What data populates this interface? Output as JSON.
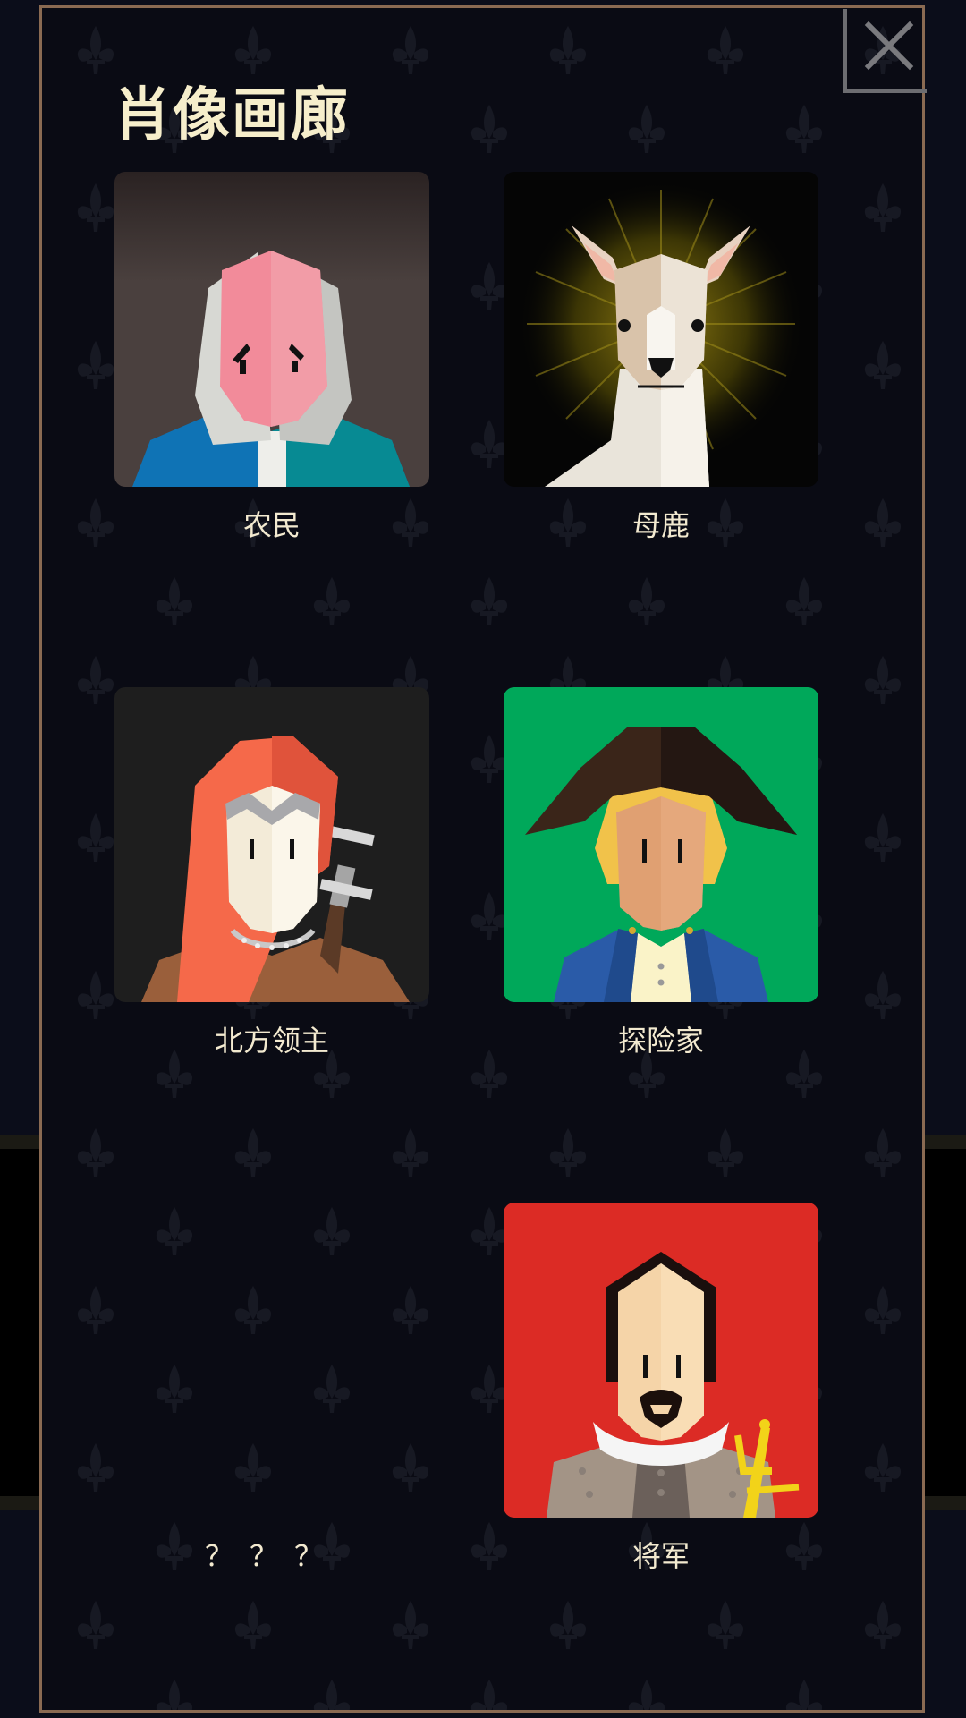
{
  "page": {
    "title": "肖像画廊",
    "close_icon": "close-icon"
  },
  "colors": {
    "background": "#0b0d1a",
    "panel_border": "#8a6a52",
    "title_text": "#f6eecb",
    "label_text": "#f3ead0"
  },
  "portraits": [
    {
      "name": "农民",
      "icon": "peasant-portrait",
      "background": "#4a403e"
    },
    {
      "name": "母鹿",
      "icon": "doe-portrait",
      "background": "#050505"
    },
    {
      "name": "北方领主",
      "icon": "northern-lord-portrait",
      "background": "#1e1e1e"
    },
    {
      "name": "探险家",
      "icon": "explorer-portrait",
      "background": "#00a85a"
    },
    {
      "name": "？？？",
      "icon": "locked-portrait",
      "background": ""
    },
    {
      "name": "将军",
      "icon": "general-portrait",
      "background": "#dc2b25"
    }
  ]
}
